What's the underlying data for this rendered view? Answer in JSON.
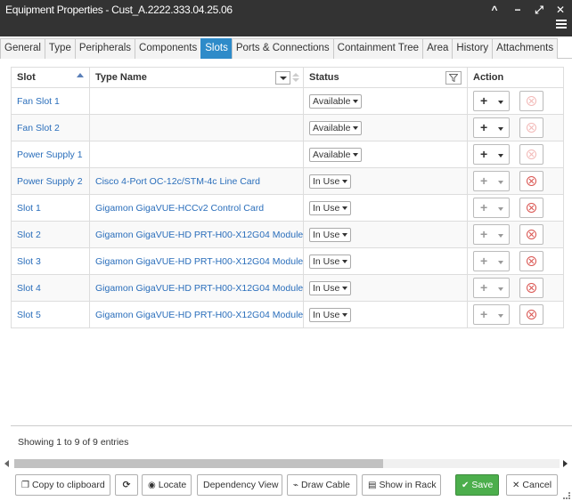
{
  "window": {
    "title": "Equipment Properties - Cust_A.2222.333.04.25.06",
    "controls": [
      "^",
      "−",
      "⤢",
      "✕"
    ]
  },
  "tabs": [
    {
      "label": "General",
      "active": false
    },
    {
      "label": "Type",
      "active": false
    },
    {
      "label": "Peripherals",
      "active": false
    },
    {
      "label": "Components",
      "active": false
    },
    {
      "label": "Slots",
      "active": true
    },
    {
      "label": "Ports & Connections",
      "active": false
    },
    {
      "label": "Containment Tree",
      "active": false
    },
    {
      "label": "Area",
      "active": false
    },
    {
      "label": "History",
      "active": false
    },
    {
      "label": "Attachments",
      "active": false
    }
  ],
  "table": {
    "headers": {
      "slot": "Slot",
      "type_name": "Type Name",
      "status": "Status",
      "action": "Action"
    },
    "rows": [
      {
        "slot": "Fan Slot 1",
        "type_name": "",
        "status": "Available",
        "add_enabled": true,
        "delete_enabled": false
      },
      {
        "slot": "Fan Slot 2",
        "type_name": "",
        "status": "Available",
        "add_enabled": true,
        "delete_enabled": false
      },
      {
        "slot": "Power Supply 1",
        "type_name": "",
        "status": "Available",
        "add_enabled": true,
        "delete_enabled": false
      },
      {
        "slot": "Power Supply 2",
        "type_name": "Cisco 4-Port OC-12c/STM-4c Line Card",
        "status": "In Use",
        "add_enabled": false,
        "delete_enabled": true
      },
      {
        "slot": "Slot 1",
        "type_name": "Gigamon GigaVUE-HCCv2 Control Card",
        "status": "In Use",
        "add_enabled": false,
        "delete_enabled": true
      },
      {
        "slot": "Slot 2",
        "type_name": "Gigamon GigaVUE-HD PRT-H00-X12G04 Module",
        "status": "In Use",
        "add_enabled": false,
        "delete_enabled": true
      },
      {
        "slot": "Slot 3",
        "type_name": "Gigamon GigaVUE-HD PRT-H00-X12G04 Module",
        "status": "In Use",
        "add_enabled": false,
        "delete_enabled": true
      },
      {
        "slot": "Slot 4",
        "type_name": "Gigamon GigaVUE-HD PRT-H00-X12G04 Module",
        "status": "In Use",
        "add_enabled": false,
        "delete_enabled": true
      },
      {
        "slot": "Slot 5",
        "type_name": "Gigamon GigaVUE-HD PRT-H00-X12G04 Module",
        "status": "In Use",
        "add_enabled": false,
        "delete_enabled": true
      }
    ]
  },
  "info": "Showing 1 to 9 of 9 entries",
  "buttons": {
    "copy": "Copy to clipboard",
    "refresh": "",
    "locate": "Locate",
    "dependency": "Dependency View",
    "draw_cable": "Draw Cable",
    "show_rack": "Show in Rack",
    "save": "Save",
    "cancel": "Cancel"
  },
  "colors": {
    "titlebar": "#333333",
    "active_tab": "#2e8bc9",
    "link": "#2a6ebb",
    "save": "#4cae4c",
    "delete": "#d9534f"
  }
}
